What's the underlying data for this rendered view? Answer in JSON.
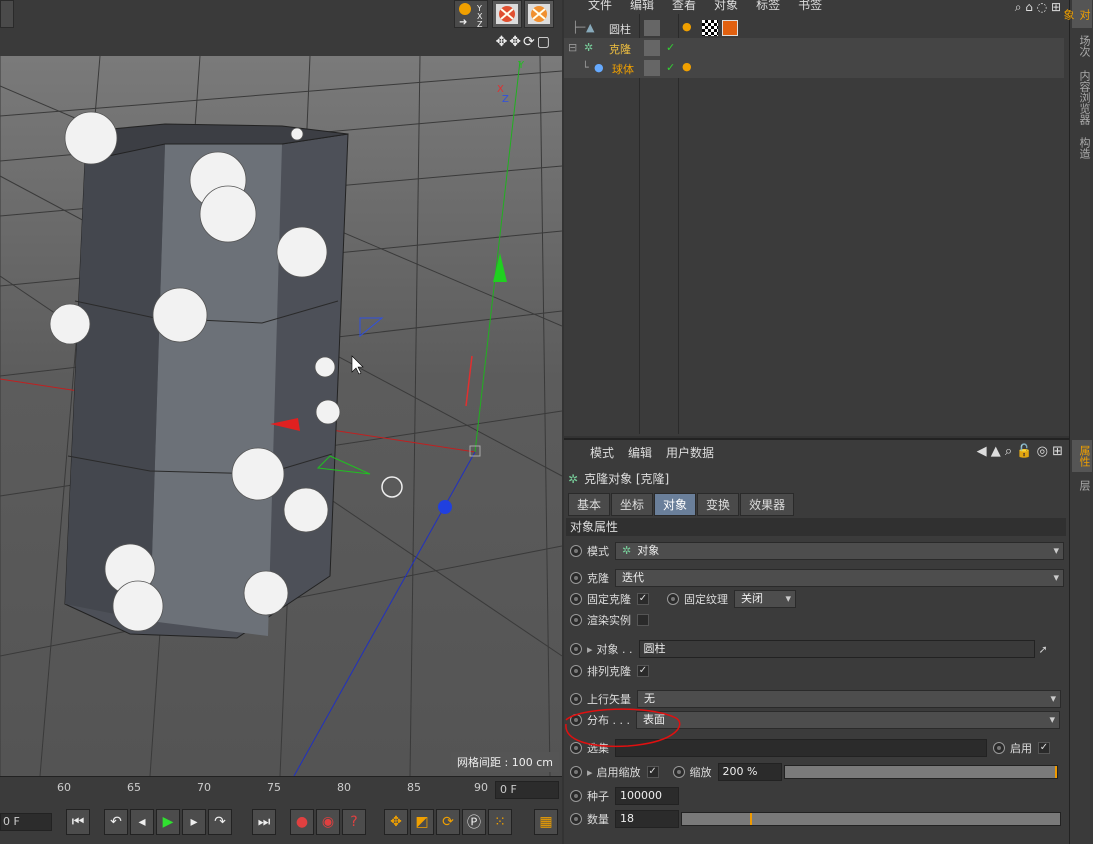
{
  "viewport": {
    "grid_spacing_label": "网格间距 : 100 cm",
    "axis_labels": {
      "y": "Y",
      "x": "X",
      "z": "Z"
    }
  },
  "timeline": {
    "ticks": [
      "60",
      "65",
      "70",
      "75",
      "80",
      "85",
      "90"
    ],
    "current_frame": "0 F",
    "start_frame": "0 F"
  },
  "object_manager": {
    "menu": [
      "文件",
      "编辑",
      "查看",
      "对象",
      "标签",
      "书签"
    ],
    "objects": [
      {
        "name": "圆柱",
        "color": "#cfcfcf"
      },
      {
        "name": "克隆",
        "color": "#f0c040"
      },
      {
        "name": "球体",
        "color": "#f0a000"
      }
    ]
  },
  "attribute_manager": {
    "menu": [
      "模式",
      "编辑",
      "用户数据"
    ],
    "title": "克隆对象 [克隆]",
    "tabs": [
      "基本",
      "坐标",
      "对象",
      "变换",
      "效果器"
    ],
    "active_tab": "对象",
    "section": "对象属性",
    "props": {
      "mode_label": "模式",
      "mode_value": "对象",
      "clone_label": "克隆",
      "clone_value": "迭代",
      "fix_clone_label": "固定克隆",
      "fix_texture_label": "固定纹理",
      "fix_texture_value": "关闭",
      "render_instance_label": "渲染实例",
      "object_label": "对象 . .",
      "object_value": "圆柱",
      "arrange_label": "排列克隆",
      "up_vector_label": "上行矢量",
      "up_vector_value": "无",
      "distribution_label": "分布 . . .",
      "distribution_value": "表面",
      "selection_label": "选集",
      "enable_label": "启用",
      "enable_scale_label": "启用缩放",
      "scale_label": "缩放",
      "scale_value": "200 %",
      "seed_label": "种子",
      "seed_value": "100000",
      "count_label": "数量",
      "count_value": "18"
    }
  },
  "side_tabs": [
    "对象",
    "场次",
    "内容浏览器",
    "构造",
    "属性",
    "层"
  ],
  "colors": {
    "accent": "#f0a000",
    "active_tab": "#6a7f9a",
    "annotation": "#e01010"
  }
}
